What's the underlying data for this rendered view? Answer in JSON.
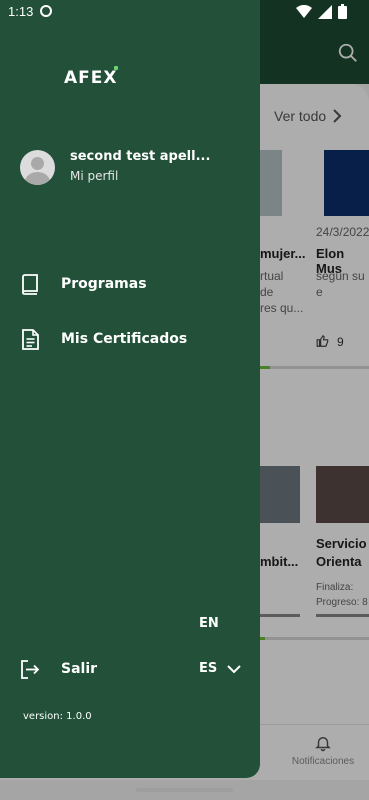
{
  "status_bar": {
    "time": "1:13",
    "icons": [
      "app-notification-icon",
      "wifi-icon",
      "signal-icon",
      "battery-icon"
    ]
  },
  "background": {
    "ver_todo": "Ver todo",
    "card_date": "24/3/2022",
    "card_title_1": "mujer...",
    "card_title_2": "Elon Mus",
    "card_text_1a": "rtual",
    "card_text_1b": "de",
    "card_text_1c": "res qu...",
    "card_text_2": "según su e",
    "likes": "9",
    "lower_title_1": "mbit...",
    "lower_title_2a": "Servicio",
    "lower_title_2b": "Orienta",
    "lower_meta_1": "Finaliza:",
    "lower_meta_2": "Progreso: 8",
    "tab_notifications": "Notificaciones",
    "accent": "#6bbf3a",
    "header_color": "#1c4a33"
  },
  "drawer": {
    "background_color": "#225038",
    "logo": "AFEX",
    "user": {
      "name": "second test apell...",
      "profile_link": "Mi perfil"
    },
    "menu": [
      {
        "label": "Programas",
        "icon": "book-icon"
      },
      {
        "label": "Mis Certificados",
        "icon": "document-icon"
      }
    ],
    "language": {
      "option_en": "EN",
      "selected": "ES"
    },
    "logout": {
      "label": "Salir",
      "icon": "logout-icon"
    },
    "version": "version: 1.0.0"
  }
}
